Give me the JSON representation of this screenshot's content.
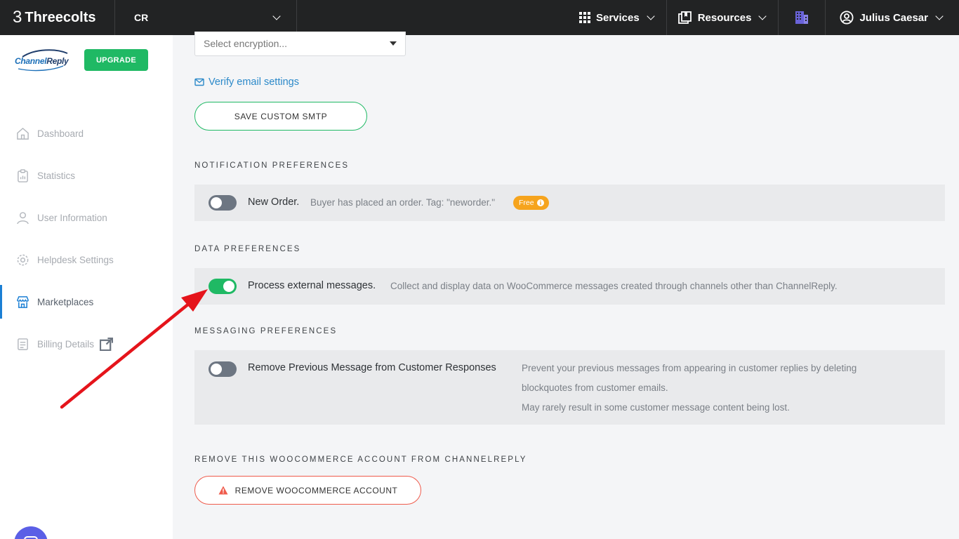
{
  "topbar": {
    "brand": "Threecolts",
    "account": "CR",
    "services_label": "Services",
    "resources_label": "Resources",
    "user_name": "Julius Caesar"
  },
  "sidebar": {
    "logo_text_a": "Channel",
    "logo_text_b": "Reply",
    "upgrade_label": "UPGRADE",
    "items": [
      {
        "label": "Dashboard",
        "icon": "home-icon"
      },
      {
        "label": "Statistics",
        "icon": "clipboard-icon"
      },
      {
        "label": "User Information",
        "icon": "user-icon"
      },
      {
        "label": "Helpdesk Settings",
        "icon": "gear-icon"
      },
      {
        "label": "Marketplaces",
        "icon": "store-icon",
        "active": true
      },
      {
        "label": "Billing Details",
        "icon": "billing-icon",
        "external": true
      }
    ]
  },
  "smtp": {
    "encryption_placeholder": "Select encryption...",
    "verify_label": "Verify email settings",
    "save_label": "SAVE CUSTOM SMTP"
  },
  "notification": {
    "heading": "NOTIFICATION PREFERENCES",
    "new_order_title": "New Order.",
    "new_order_desc": "Buyer has placed an order. Tag: \"neworder.\"",
    "badge": "Free",
    "enabled": false
  },
  "data_prefs": {
    "heading": "DATA PREFERENCES",
    "title": "Process external messages.",
    "desc": "Collect and display data on WooCommerce messages created through channels other than ChannelReply.",
    "enabled": true
  },
  "messaging": {
    "heading": "MESSAGING PREFERENCES",
    "title": "Remove Previous Message from Customer Responses",
    "desc_line1": "Prevent your previous messages from appearing in customer replies by deleting",
    "desc_line2": "blockquotes from customer emails.",
    "desc_line3": "May rarely result in some customer message content being lost.",
    "enabled": false
  },
  "remove": {
    "heading": "REMOVE THIS WOOCOMMERCE ACCOUNT FROM CHANNELREPLY",
    "button_label": "REMOVE WOOCOMMERCE ACCOUNT"
  },
  "colors": {
    "accent_green": "#1fb964",
    "topbar": "#222324",
    "danger": "#ef5b4c",
    "annotation_arrow": "#e5141b"
  }
}
